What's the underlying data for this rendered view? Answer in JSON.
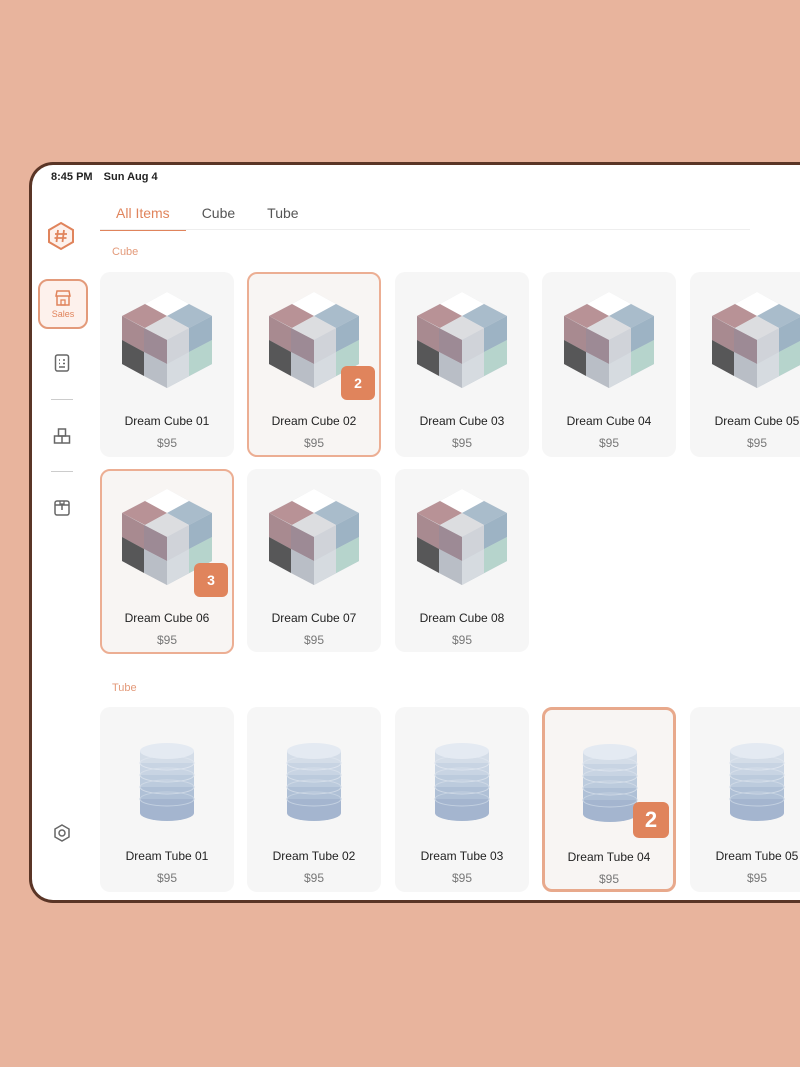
{
  "status": {
    "time": "8:45 PM",
    "date": "Sun Aug 4"
  },
  "sidebar": {
    "logo": "hashtag-hexagon-icon",
    "sales_label": "Sales",
    "icons": [
      "receipt-icon",
      "inventory-icon",
      "box-icon"
    ],
    "settings_icon": "settings-icon"
  },
  "tabs": [
    "All Items",
    "Cube",
    "Tube"
  ],
  "sections": {
    "cube": "Cube",
    "tube": "Tube"
  },
  "cubes": [
    {
      "name": "Dream Cube 01",
      "price": "$95"
    },
    {
      "name": "Dream Cube 02",
      "price": "$95",
      "qty": "2"
    },
    {
      "name": "Dream Cube 03",
      "price": "$95"
    },
    {
      "name": "Dream Cube 04",
      "price": "$95"
    },
    {
      "name": "Dream Cube 05",
      "price": "$95"
    },
    {
      "name": "Dream Cube 06",
      "price": "$95",
      "qty": "3"
    },
    {
      "name": "Dream Cube 07",
      "price": "$95"
    },
    {
      "name": "Dream Cube 08",
      "price": "$95"
    }
  ],
  "tubes": [
    {
      "name": "Dream Tube 01",
      "price": "$95"
    },
    {
      "name": "Dream Tube 02",
      "price": "$95"
    },
    {
      "name": "Dream Tube 03",
      "price": "$95"
    },
    {
      "name": "Dream Tube 04",
      "price": "$95",
      "qty": "2"
    },
    {
      "name": "Dream Tube 05",
      "price": "$95"
    }
  ],
  "colors": {
    "accent": "#e0845c",
    "background": "#e8b49d",
    "frame": "#5a3526"
  }
}
